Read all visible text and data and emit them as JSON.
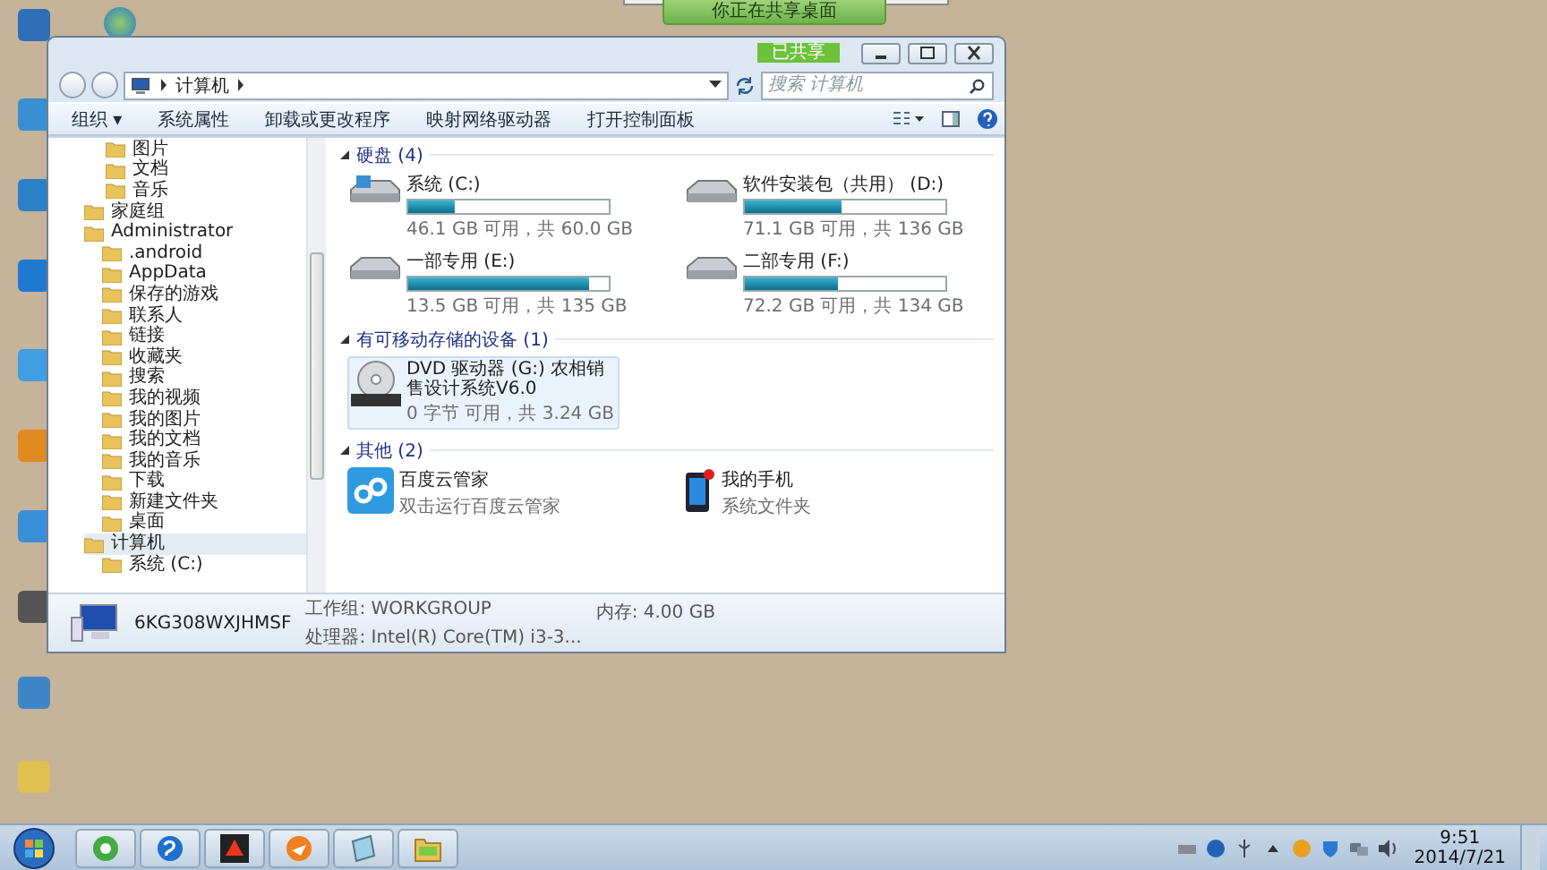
{
  "share_banner": {
    "text": "你正在共享桌面"
  },
  "window": {
    "share_badge": "已共享",
    "address": {
      "path": "计算机"
    },
    "search": {
      "placeholder": "搜索 计算机"
    },
    "toolbar": [
      "组织 ▾",
      "系统属性",
      "卸载或更改程序",
      "映射网络驱动器",
      "打开控制面板"
    ],
    "sidebar": {
      "library_items": [
        {
          "label": "图片"
        },
        {
          "label": "文档"
        },
        {
          "label": "音乐"
        }
      ],
      "items": [
        {
          "label": "家庭组",
          "selected": false
        },
        {
          "label": "Administrator",
          "selected": false,
          "children": [
            {
              "label": ".android",
              "selected": false
            },
            {
              "label": "AppData",
              "selected": false
            },
            {
              "label": "保存的游戏",
              "selected": false
            },
            {
              "label": "联系人",
              "selected": false
            },
            {
              "label": "链接",
              "selected": false
            },
            {
              "label": "收藏夹",
              "selected": false
            },
            {
              "label": "搜索",
              "selected": false
            },
            {
              "label": "我的视频",
              "selected": false
            },
            {
              "label": "我的图片",
              "selected": false
            },
            {
              "label": "我的文档",
              "selected": false
            },
            {
              "label": "我的音乐",
              "selected": false
            },
            {
              "label": "下载",
              "selected": false
            },
            {
              "label": "新建文件夹",
              "selected": false
            },
            {
              "label": "桌面",
              "selected": false
            }
          ]
        },
        {
          "label": "计算机",
          "selected": true,
          "children": [
            {
              "label": "系统 (C:)",
              "selected": false
            }
          ]
        }
      ]
    },
    "groups": [
      {
        "kind": "drives",
        "title": "硬盘 (4)",
        "items": [
          {
            "name": "系统 (C:)",
            "level": 0.23,
            "free": "46.1 GB 可用，共 60.0 GB"
          },
          {
            "name": "软件安装包（共用） (D:)",
            "level": 0.48,
            "free": "71.1 GB 可用，共 136 GB"
          },
          {
            "name": "一部专用 (E:)",
            "level": 0.9,
            "free": "13.5 GB 可用，共 135 GB"
          },
          {
            "name": "二部专用 (F:)",
            "level": 0.46,
            "free": "72.2 GB 可用，共 134 GB"
          }
        ]
      },
      {
        "kind": "devices",
        "title": "有可移动存储的设备 (1)",
        "items": [
          {
            "name": "DVD 驱动器 (G:) 农相销售设计系统V6.0",
            "free": "0 字节 可用，共 3.24 GB",
            "selected": true
          }
        ]
      },
      {
        "kind": "other",
        "title": "其他 (2)",
        "items": [
          {
            "name": "百度云管家",
            "detail": "双击运行百度云管家"
          },
          {
            "name": "我的手机",
            "detail": "系统文件夹"
          }
        ]
      }
    ],
    "details": {
      "computer_name": "6KG308WXJHMSF",
      "workgroup": "工作组: WORKGROUP",
      "memory": "内存: 4.00 GB",
      "processor": "处理器: Intel(R) Core(TM) i3-3..."
    }
  },
  "taskbar": {
    "time": "9:51",
    "date": "2014/7/21"
  }
}
